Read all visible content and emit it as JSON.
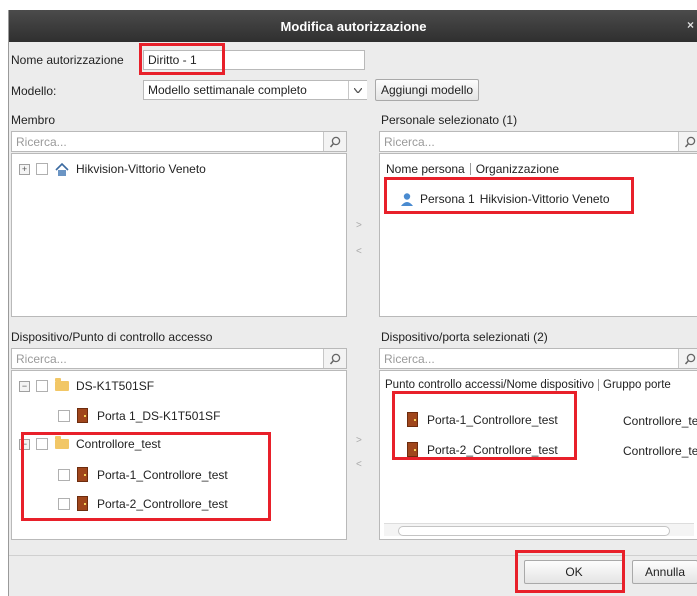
{
  "dialog": {
    "title": "Modifica autorizzazione",
    "close_glyph": "×"
  },
  "form": {
    "name_label": "Nome autorizzazione",
    "name_value": "Diritto - 1",
    "model_label": "Modello:",
    "model_value": "Modello settimanale completo",
    "add_model_label": "Aggiungi modello"
  },
  "member": {
    "label": "Membro",
    "search_placeholder": "Ricerca...",
    "tree": [
      {
        "label": "Hikvision-Vittorio Veneto",
        "icon": "home-icon"
      }
    ]
  },
  "selected_personnel": {
    "label": "Personale selezionato (1)",
    "search_placeholder": "Ricerca...",
    "columns": [
      "Nome persona",
      "Organizzazione"
    ],
    "rows": [
      {
        "name": "Persona 1",
        "org": "Hikvision-Vittorio Veneto",
        "icon": "person-icon"
      }
    ]
  },
  "transfer": {
    "add_glyph": ">",
    "remove_glyph": "<"
  },
  "devices": {
    "label": "Dispositivo/Punto di controllo accesso",
    "search_placeholder": "Ricerca...",
    "tree": [
      {
        "label": "DS-K1T501SF",
        "children": [
          "Porta 1_DS-K1T501SF"
        ]
      },
      {
        "label": "Controllore_test",
        "children": [
          "Porta-1_Controllore_test",
          "Porta-2_Controllore_test"
        ]
      }
    ]
  },
  "selected_devices": {
    "label": "Dispositivo/porta selezionati (2)",
    "search_placeholder": "Ricerca...",
    "columns": [
      "Punto controllo accessi/Nome dispositivo",
      "Gruppo porte"
    ],
    "rows": [
      {
        "name": "Porta-1_Controllore_test",
        "group": "Controllore_te"
      },
      {
        "name": "Porta-2_Controllore_test",
        "group": "Controllore_te"
      }
    ]
  },
  "footer": {
    "ok_label": "OK",
    "cancel_label": "Annulla"
  },
  "colors": {
    "highlight": "#e8202a",
    "titlebar": "#3a3a3a"
  }
}
